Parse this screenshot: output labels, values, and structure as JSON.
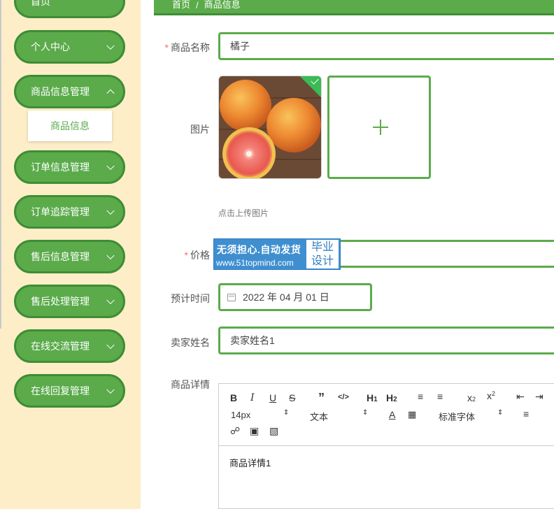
{
  "sidebar": {
    "items": [
      {
        "label": "首页"
      },
      {
        "label": "个人中心"
      },
      {
        "label": "商品信息管理"
      },
      {
        "label": "订单信息管理"
      },
      {
        "label": "订单追踪管理"
      },
      {
        "label": "售后信息管理"
      },
      {
        "label": "售后处理管理"
      },
      {
        "label": "在线交流管理"
      },
      {
        "label": "在线回复管理"
      }
    ],
    "submenu_item": "商品信息"
  },
  "breadcrumb": {
    "home": "首页",
    "separator": "/",
    "current": "商品信息"
  },
  "form": {
    "name": {
      "label": "商品名称",
      "required_mark": "*",
      "value": "橘子"
    },
    "image": {
      "label": "图片",
      "upload_tip": "点击上传图片"
    },
    "price": {
      "label": "价格",
      "required_mark": "*",
      "value": ""
    },
    "time": {
      "label": "预计时间",
      "value": "2022 年 04 月 01 日"
    },
    "seller": {
      "label": "卖家姓名",
      "value": "卖家姓名1"
    },
    "detail": {
      "label": "商品详情",
      "value": "商品详情1"
    }
  },
  "editor": {
    "font_size": "14px",
    "text_type": "文本",
    "font_family": "标准字体"
  },
  "watermark": {
    "line1": "无须担心.自动发货",
    "line2": "www.51topmind.com",
    "badge": "毕业 设计"
  },
  "colors": {
    "accent": "#5bab4b",
    "accent_dark": "#3e8d35",
    "sidebar_bg": "#fdeec8",
    "required": "#f56c6c"
  }
}
